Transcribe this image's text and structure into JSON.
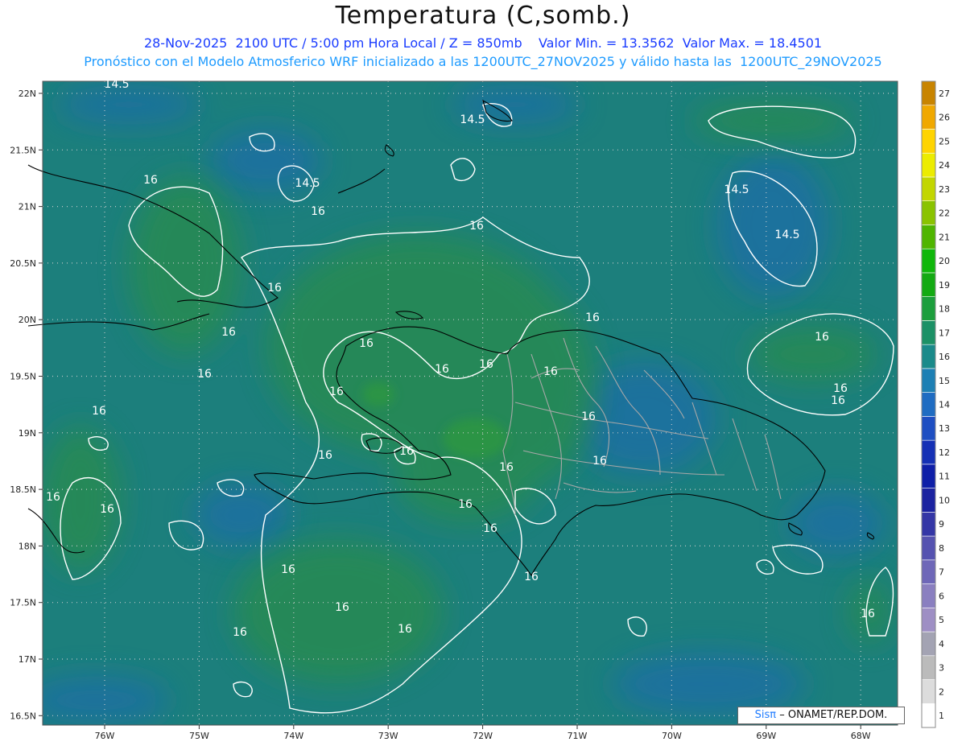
{
  "header": {
    "title": "Temperatura (C,somb.)",
    "line1": "28-Nov-2025  2100 UTC / 5:00 pm Hora Local / Z = 850mb    Valor Min. = 13.3562  Valor Max. = 18.4501",
    "line2": "Pronóstico con el Modelo Atmosferico WRF inicializado a las 1200UTC_27NOV2025 y válido hasta las  1200UTC_29NOV2025"
  },
  "axes": {
    "lat_labels": [
      "22N",
      "21.5N",
      "21N",
      "20.5N",
      "20N",
      "19.5N",
      "19N",
      "18.5N",
      "18N",
      "17.5N",
      "17N",
      "16.5N"
    ],
    "lon_labels": [
      "76W",
      "75W",
      "74W",
      "73W",
      "72W",
      "71W",
      "70W",
      "69W",
      "68W"
    ]
  },
  "colorbar": {
    "labels": [
      "1",
      "2",
      "3",
      "4",
      "5",
      "6",
      "7",
      "8",
      "9",
      "10",
      "11",
      "12",
      "13",
      "14",
      "15",
      "16",
      "17",
      "18",
      "19",
      "20",
      "21",
      "22",
      "23",
      "24",
      "25",
      "26",
      "27"
    ],
    "colors": [
      "#ffffff",
      "#dcdcdc",
      "#bbbbbb",
      "#a3a3b3",
      "#9e8fc4",
      "#8a7fc0",
      "#6e67b8",
      "#5552b0",
      "#3436a6",
      "#1b22a0",
      "#0f1fa8",
      "#1530b5",
      "#1e4ec2",
      "#1f6cc2",
      "#1d7fb4",
      "#1a8a8a",
      "#1c9166",
      "#1c9e3c",
      "#13aa12",
      "#0fb70a",
      "#4fb500",
      "#8ac300",
      "#c2d600",
      "#ecec00",
      "#ffd400",
      "#f0a800",
      "#c88400"
    ]
  },
  "contours": {
    "labels": [
      "14.5",
      "14.5",
      "14.5",
      "14.5",
      "14.5",
      "16",
      "16",
      "16",
      "16",
      "16",
      "16",
      "16",
      "16",
      "16",
      "16",
      "16",
      "16",
      "16",
      "16",
      "16",
      "16",
      "16",
      "16",
      "16",
      "16",
      "16",
      "16",
      "16",
      "16",
      "16",
      "16",
      "16",
      "16",
      "16",
      "16",
      "16"
    ]
  },
  "credit": {
    "brand": "Sisπ",
    "text": "– ONAMET/REP.DOM."
  },
  "colors": {
    "sea_base": "#1c7f7c",
    "cool_zone": "#1f6fa3",
    "warm_zone": "#268a55",
    "contour": "#ffffff",
    "coast": "#000000",
    "province": "#a8a8a8"
  }
}
